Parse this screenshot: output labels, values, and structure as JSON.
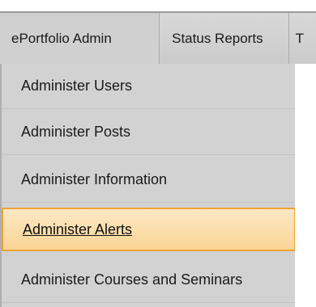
{
  "menubar": {
    "tabs": [
      {
        "label": "ePortfolio Admin"
      },
      {
        "label": "Status Reports"
      },
      {
        "label": "T"
      }
    ]
  },
  "dropdown": {
    "items": [
      {
        "label": "Administer Users"
      },
      {
        "label": "Administer Posts"
      },
      {
        "label": "Administer Information"
      },
      {
        "label": "Administer Alerts"
      },
      {
        "label": "Administer Courses and Seminars"
      }
    ]
  },
  "colors": {
    "menu_bg": "#d2d2d2",
    "highlight_bg": "#fbdda9",
    "highlight_border": "#f1a23b"
  }
}
